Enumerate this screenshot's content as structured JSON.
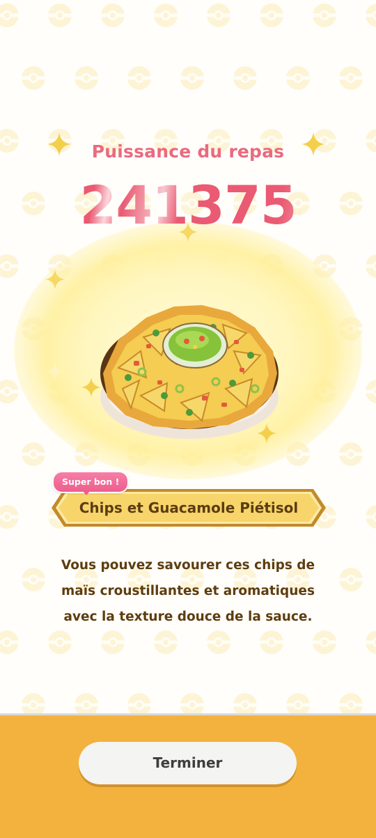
{
  "result": {
    "power_label": "Puissance du repas",
    "power_value": "241375"
  },
  "dish": {
    "name": "Chips et Guacamole Piétisol",
    "rating_badge": "Super bon !",
    "description_lines": [
      "Vous pouvez savourer ces chips de",
      "maïs croustillantes et aromatiques",
      "avec la texture douce de la sauce."
    ],
    "illustration_icon": "nachos-guacamole-plate-icon"
  },
  "footer": {
    "finish_label": "Terminer"
  },
  "colors": {
    "power_text": "#ea5a72",
    "banner_gold": "#f8d56a",
    "banner_border": "#c38a2a",
    "badge_pink": "#ee5d8c",
    "description_text": "#5e3d0f",
    "footer_orange": "#f3b23e",
    "button_bg": "#f4f4f2",
    "pattern": "#fbf1cf"
  }
}
